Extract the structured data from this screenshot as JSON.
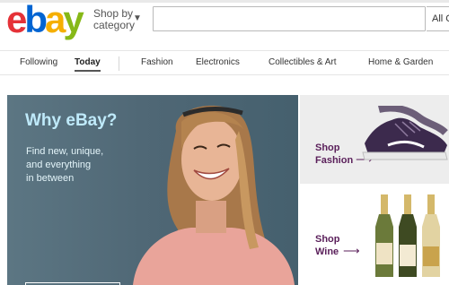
{
  "header": {
    "logo": {
      "e": "e",
      "b": "b",
      "a": "a",
      "y": "y"
    },
    "shop_by_line1": "Shop by",
    "shop_by_line2": "category",
    "search_placeholder": "",
    "category_select": "All C"
  },
  "nav": {
    "items": [
      "Following",
      "Today",
      "Fashion",
      "Electronics",
      "Collectibles & Art",
      "Home & Garden"
    ],
    "active": "Today"
  },
  "hero": {
    "title": "Why eBay?",
    "lines": [
      "Find new, unique,",
      "and everything",
      "in between"
    ]
  },
  "tiles": [
    {
      "line1": "Shop",
      "line2": "Fashion",
      "arrow": "⟶"
    },
    {
      "line1": "Shop",
      "line2": "Wine",
      "arrow": "⟶"
    }
  ],
  "colors": {
    "brand_red": "#e53238",
    "brand_blue": "#0064d2",
    "brand_yellow": "#f5af02",
    "brand_green": "#86b817",
    "hero_bg": "#4f6775",
    "tile_text": "#5a1f5a"
  }
}
